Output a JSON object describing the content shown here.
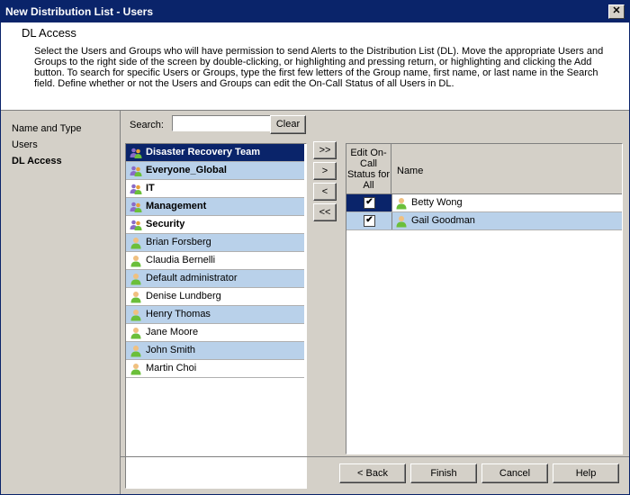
{
  "window": {
    "title": "New Distribution List - Users",
    "close_label": "✕"
  },
  "header": {
    "title": "DL Access",
    "description": "Select the Users and Groups who will have permission to send Alerts to the Distribution List (DL). Move the appropriate Users and Groups to the right side of the screen by double-clicking, or highlighting and pressing return, or highlighting and clicking the Add button. To search for specific Users or Groups, type the first few letters of the Group name, first name, or last name in the Search field. Define whether or not the Users and Groups can edit the On-Call Status of all Users in DL."
  },
  "nav": {
    "items": [
      "Name and Type",
      "Users",
      "DL Access"
    ]
  },
  "search": {
    "label": "Search:",
    "value": "",
    "clear_label": "Clear"
  },
  "available": [
    {
      "name": "Disaster Recovery Team",
      "type": "group"
    },
    {
      "name": "Everyone_Global",
      "type": "group"
    },
    {
      "name": "IT",
      "type": "group"
    },
    {
      "name": "Management",
      "type": "group"
    },
    {
      "name": "Security",
      "type": "group"
    },
    {
      "name": "Brian Forsberg",
      "type": "user"
    },
    {
      "name": "Claudia Bernelli",
      "type": "user"
    },
    {
      "name": "Default administrator",
      "type": "user"
    },
    {
      "name": "Denise Lundberg",
      "type": "user"
    },
    {
      "name": "Henry Thomas",
      "type": "user"
    },
    {
      "name": "Jane Moore",
      "type": "user"
    },
    {
      "name": "John Smith",
      "type": "user"
    },
    {
      "name": "Martin Choi",
      "type": "user"
    }
  ],
  "move_buttons": [
    ">>",
    ">",
    "<",
    "<<"
  ],
  "selected_table": {
    "col_edit": "Edit On-Call Status for All",
    "col_name": "Name",
    "rows": [
      {
        "name": "Betty Wong",
        "checked": true
      },
      {
        "name": "Gail Goodman",
        "checked": true
      }
    ]
  },
  "footer": {
    "back": "< Back",
    "finish": "Finish",
    "cancel": "Cancel",
    "help": "Help"
  },
  "icons": {
    "user": "user-icon",
    "group": "group-icon"
  },
  "colors": {
    "selection": "#0a246a",
    "alt_row": "#b9d1ea",
    "user_icon": "#6bbf3a",
    "group_icon": "#8a6bc8"
  }
}
